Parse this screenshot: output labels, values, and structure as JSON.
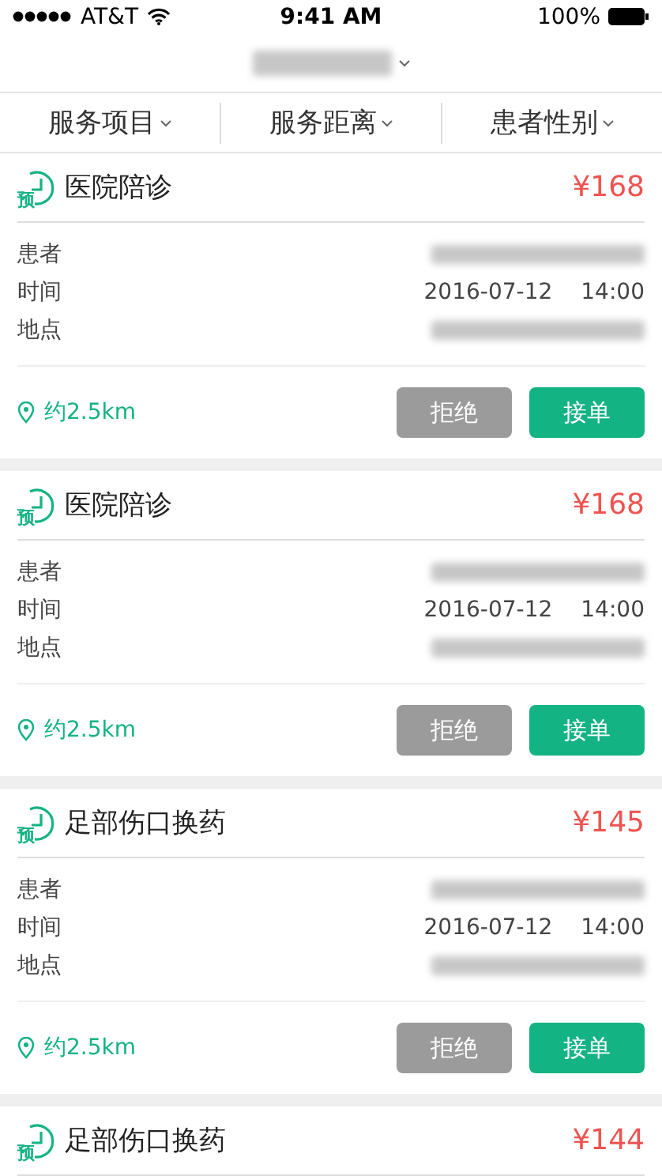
{
  "status_bar": {
    "carrier": "AT&T",
    "time": "9:41 AM",
    "battery": "100%"
  },
  "filters": [
    {
      "label": "服务项目"
    },
    {
      "label": "服务距离"
    },
    {
      "label": "患者性别"
    }
  ],
  "orders": [
    {
      "badge": "预",
      "title": "医院陪诊",
      "price": "¥168",
      "fields": [
        {
          "label": "患者",
          "kind": "blurred"
        },
        {
          "label": "时间",
          "kind": "text",
          "date": "2016-07-12",
          "time": "14:00"
        },
        {
          "label": "地点",
          "kind": "blurred"
        }
      ],
      "distance": "约2.5km",
      "reject": "拒绝",
      "accept": "接单"
    },
    {
      "badge": "预",
      "title": "医院陪诊",
      "price": "¥168",
      "fields": [
        {
          "label": "患者",
          "kind": "blurred"
        },
        {
          "label": "时间",
          "kind": "text",
          "date": "2016-07-12",
          "time": "14:00"
        },
        {
          "label": "地点",
          "kind": "blurred"
        }
      ],
      "distance": "约2.5km",
      "reject": "拒绝",
      "accept": "接单"
    },
    {
      "badge": "预",
      "title": "足部伤口换药",
      "price": "¥145",
      "fields": [
        {
          "label": "患者",
          "kind": "blurred"
        },
        {
          "label": "时间",
          "kind": "text",
          "date": "2016-07-12",
          "time": "14:00"
        },
        {
          "label": "地点",
          "kind": "blurred"
        }
      ],
      "distance": "约2.5km",
      "reject": "拒绝",
      "accept": "接单"
    },
    {
      "badge": "预",
      "title": "足部伤口换药",
      "price": "¥144"
    }
  ]
}
